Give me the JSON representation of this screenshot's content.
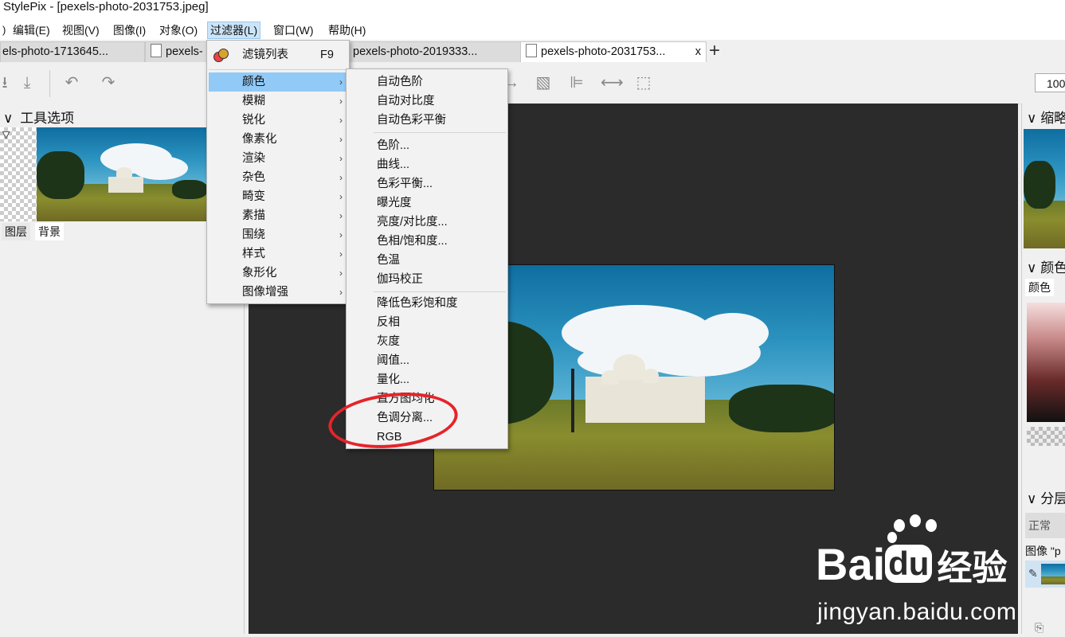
{
  "window": {
    "title": "StylePix - [pexels-photo-2031753.jpeg]"
  },
  "menubar": {
    "items": [
      "编辑(E)",
      "视图(V)",
      "图像(I)",
      "对象(O)",
      "过滤器(L)",
      "窗口(W)",
      "帮助(H)"
    ],
    "active": "过滤器(L)"
  },
  "tabs": [
    {
      "label": "els-photo-1713645..."
    },
    {
      "label": "pexels-"
    },
    {
      "label": "pexels-photo-2019333..."
    },
    {
      "label": "pexels-photo-2031753...",
      "close": "x"
    }
  ],
  "toolbar": {
    "zoom": "100"
  },
  "left_panel": {
    "title": "工具选项",
    "tabs": [
      "图层",
      "背景"
    ]
  },
  "right_panel": {
    "thumb_title": "缩略",
    "color_title": "颜色",
    "color_tab": "颜色",
    "layers_title": "分层",
    "blend_mode": "正常",
    "image_label": "图像 \"p"
  },
  "filter_menu": {
    "items": [
      {
        "label": "滤镜列表",
        "shortcut": "F9"
      },
      {
        "label": "颜色",
        "submenu": true,
        "highlighted": true
      },
      {
        "label": "模糊",
        "submenu": true
      },
      {
        "label": "锐化",
        "submenu": true
      },
      {
        "label": "像素化",
        "submenu": true
      },
      {
        "label": "渲染",
        "submenu": true
      },
      {
        "label": "杂色",
        "submenu": true
      },
      {
        "label": "畸变",
        "submenu": true
      },
      {
        "label": "素描",
        "submenu": true
      },
      {
        "label": "围绕",
        "submenu": true
      },
      {
        "label": "样式",
        "submenu": true
      },
      {
        "label": "象形化",
        "submenu": true
      },
      {
        "label": "图像增强",
        "submenu": true
      }
    ]
  },
  "color_submenu": {
    "groups": [
      [
        "自动色阶",
        "自动对比度",
        "自动色彩平衡"
      ],
      [
        "色阶...",
        "曲线...",
        "色彩平衡...",
        "曝光度",
        "亮度/对比度...",
        "色相/饱和度...",
        "色温",
        "伽玛校正"
      ],
      [
        "降低色彩饱和度",
        "反相",
        "灰度",
        "阈值...",
        "量化...",
        "直方图均化",
        "色调分离...",
        "RGB"
      ]
    ]
  },
  "watermark": {
    "brand": "Bai",
    "brand2": "du",
    "site_cn": "经验",
    "url": "jingyan.baidu.com"
  },
  "colors": {
    "menu_highlight": "#91c9f7",
    "canvas_bg": "#2b2b2b",
    "annotation": "#e5242a"
  }
}
